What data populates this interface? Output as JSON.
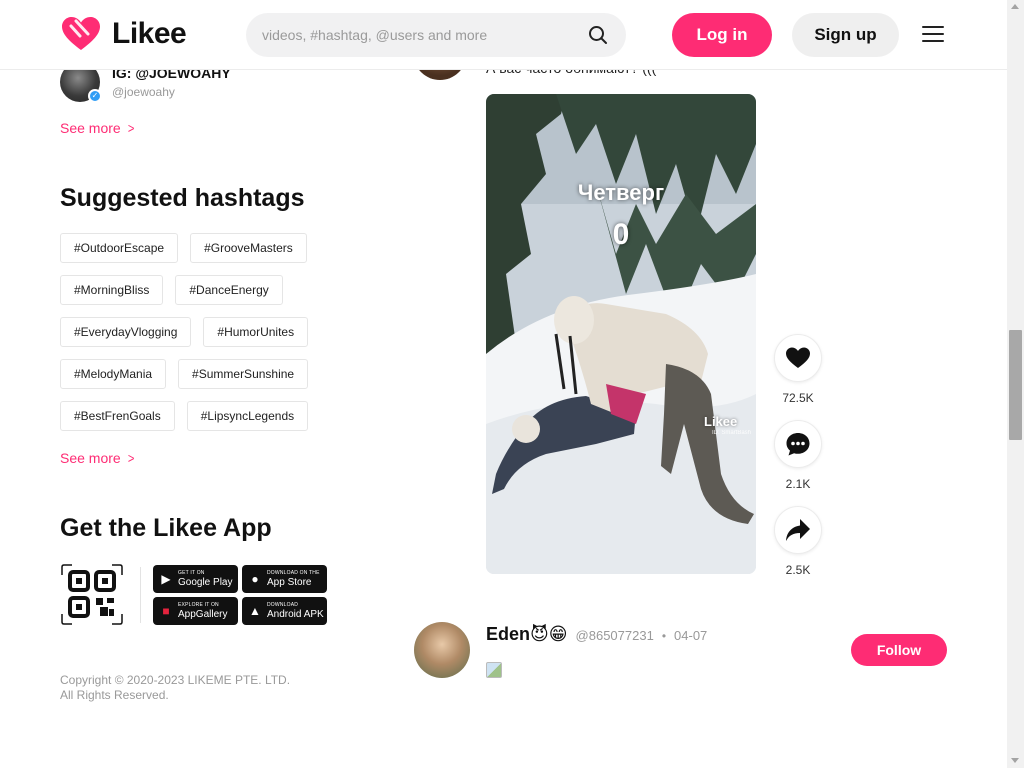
{
  "header": {
    "logo_text": "Likee",
    "search_placeholder": "videos, #hashtag, @users and more",
    "login_label": "Log in",
    "signup_label": "Sign up"
  },
  "sidebar": {
    "suggested_user": {
      "name": "IG: @JOEWOAHY",
      "handle": "@joewoahy"
    },
    "see_more_label": "See more",
    "hashtags_title": "Suggested hashtags",
    "hashtags": [
      "#OutdoorEscape",
      "#GrooveMasters",
      "#MorningBliss",
      "#DanceEnergy",
      "#EverydayVlogging",
      "#HumorUnites",
      "#MelodyMania",
      "#SummerSunshine",
      "#BestFrenGoals",
      "#LipsyncLegends"
    ],
    "app_title": "Get the Likee App",
    "stores": {
      "google_small": "GET IT ON",
      "google_big": "Google Play",
      "apple_small": "DOWNLOAD ON THE",
      "apple_big": "App Store",
      "huawei_small": "EXPLORE IT ON",
      "huawei_big": "AppGallery",
      "apk_small": "DOWNLOAD",
      "apk_big": "Android APK"
    },
    "copyright_line1": "Copyright © 2020-2023 LIKEME PTE. LTD.",
    "copyright_line2": "All Rights Reserved."
  },
  "feed": {
    "top_post_caption": "А вас часто обнимают? (((",
    "video": {
      "overlay_title": "Четверг",
      "overlay_count": "0",
      "watermark": "Likee",
      "watermark_sub": "ID: SmartBash"
    },
    "actions": {
      "likes": "72.5K",
      "comments": "2.1K",
      "shares": "2.5K"
    },
    "next_post": {
      "name": "Eden😈😁",
      "handle": "@865077231",
      "separator": "•",
      "date": "04-07",
      "follow_label": "Follow"
    }
  },
  "colors": {
    "brand": "#fe2c74",
    "text": "#111111",
    "muted": "#999999"
  },
  "icons": [
    "heart-logo-icon",
    "search-icon",
    "menu-icon",
    "verified-icon",
    "chevron-right-icon",
    "qr-code-icon",
    "heart-icon",
    "comment-icon",
    "share-icon"
  ]
}
